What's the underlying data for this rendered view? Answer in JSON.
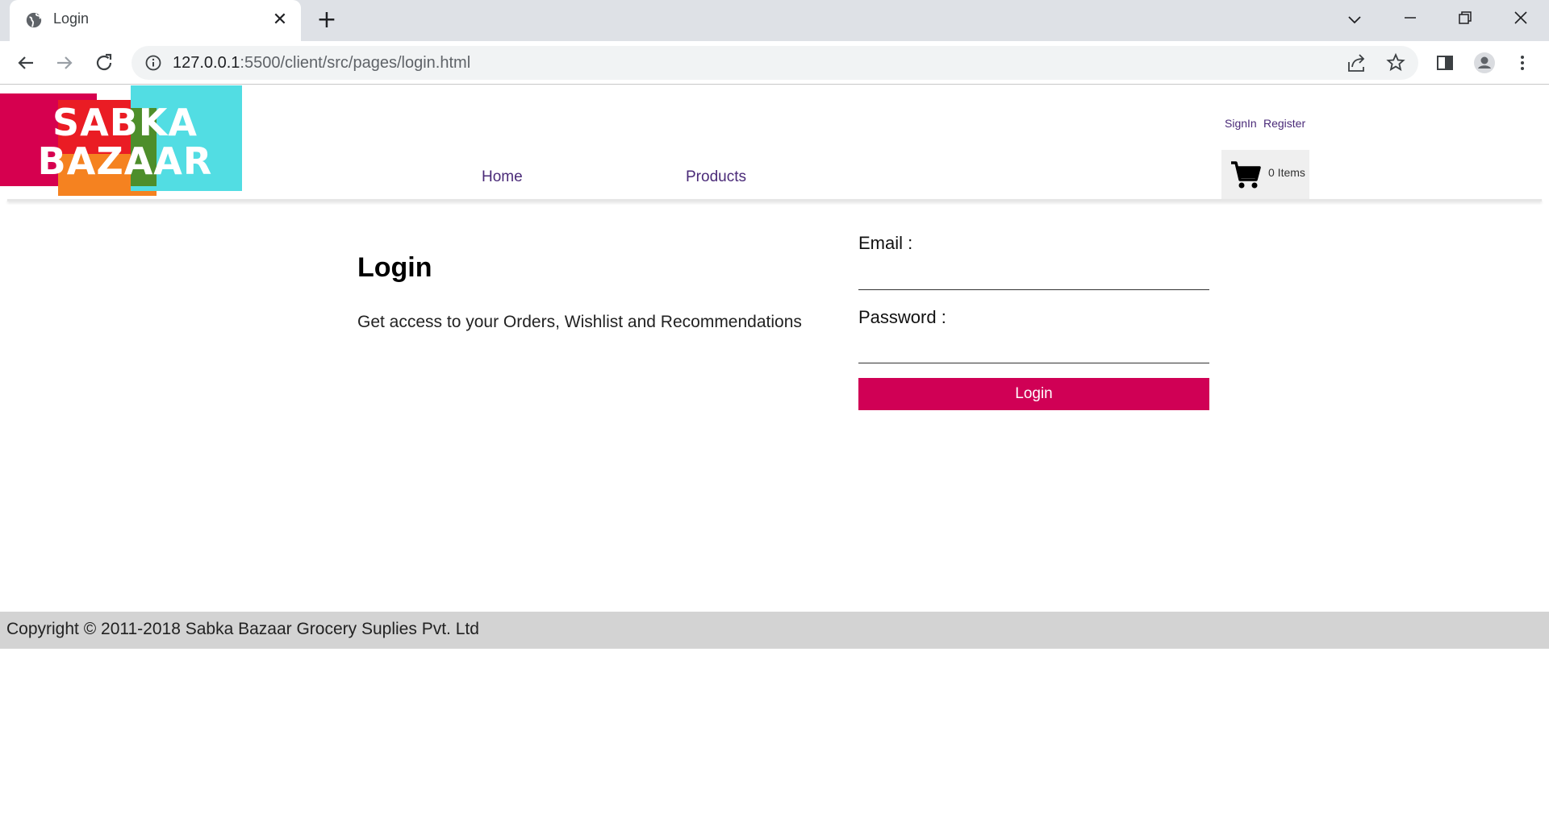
{
  "browser": {
    "tab_title": "Login",
    "url_host": "127.0.0.1",
    "url_rest": ":5500/client/src/pages/login.html"
  },
  "site": {
    "logo_line1": "SABKA",
    "logo_line2": "BAZAAR",
    "nav": {
      "home": "Home",
      "products": "Products"
    },
    "auth": {
      "signin": "SignIn",
      "register": "Register"
    },
    "cart": {
      "count_label": "0 Items"
    }
  },
  "login": {
    "title": "Login",
    "subtitle": "Get access to your Orders, Wishlist and Recommendations",
    "email_label": "Email :",
    "email_value": "",
    "password_label": "Password :",
    "password_value": "",
    "button_label": "Login"
  },
  "footer": {
    "copyright": "Copyright © 2011-2018 Sabka Bazaar Grocery Suplies Pvt. Ltd"
  },
  "colors": {
    "accent": "#d00055",
    "nav_link": "#4a2a78",
    "footer_bg": "#d3d3d3",
    "logo_pink": "#d6004f",
    "logo_red": "#ea1c24",
    "logo_orange": "#f58220",
    "logo_green": "#4d8e2b",
    "logo_cyan": "#52dde3"
  }
}
